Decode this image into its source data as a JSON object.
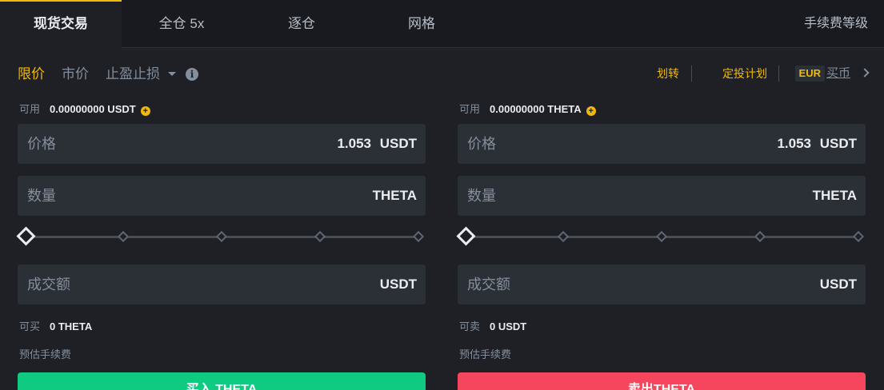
{
  "tabs": {
    "spot": "现货交易",
    "cross": "全仓 5x",
    "isolated": "逐仓",
    "grid": "网格",
    "fee_level": "手续费等级"
  },
  "order_types": {
    "limit": "限价",
    "market": "市价",
    "stop": "止盈止损"
  },
  "actions": {
    "transfer": "划转",
    "plan": "定投计划",
    "currency": "EUR",
    "buy_coin": "买币"
  },
  "buy": {
    "available_label": "可用",
    "available_value": "0.00000000 USDT",
    "price_label": "价格",
    "price_value": "1.053",
    "price_unit": "USDT",
    "amount_label": "数量",
    "amount_unit": "THETA",
    "total_label": "成交额",
    "total_unit": "USDT",
    "max_label": "可买",
    "max_value": "0 THETA",
    "fee_label": "预估手续费",
    "button": "买入 THETA",
    "slider_percent": 0
  },
  "sell": {
    "available_label": "可用",
    "available_value": "0.00000000 THETA",
    "price_label": "价格",
    "price_value": "1.053",
    "price_unit": "USDT",
    "amount_label": "数量",
    "amount_unit": "THETA",
    "total_label": "成交额",
    "total_unit": "USDT",
    "max_label": "可卖",
    "max_value": "0 USDT",
    "fee_label": "预估手续费",
    "button": "卖出THETA",
    "slider_percent": 0
  },
  "colors": {
    "accent": "#f0b90b",
    "buy": "#0ecb81",
    "sell": "#f6465d",
    "background": "#1e2026"
  },
  "icons": {
    "info": "info-icon",
    "add": "plus-circle-icon",
    "dropdown": "caret-down-icon",
    "next": "chevron-right-icon"
  }
}
